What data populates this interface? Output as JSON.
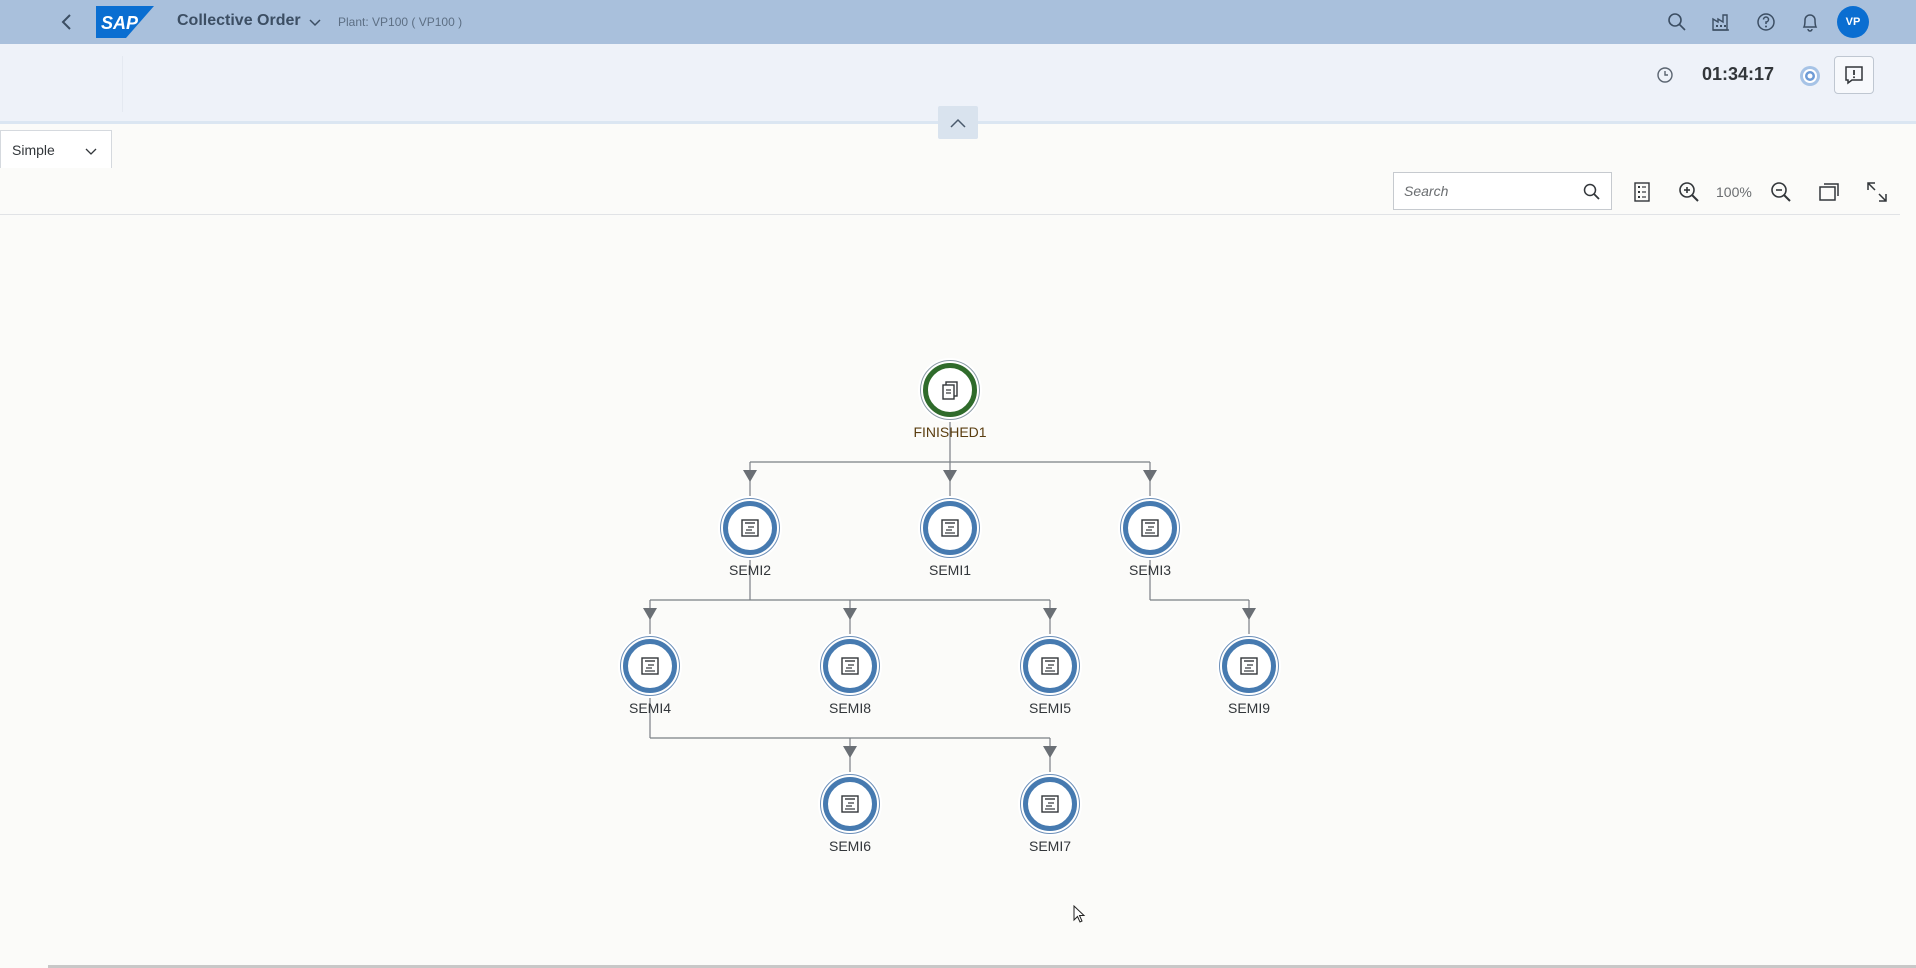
{
  "shell": {
    "title": "Collective Order",
    "plant": "Plant: VP100 ( VP100 )",
    "avatar_initials": "VP",
    "logo_text": "SAP"
  },
  "header": {
    "timer": "01:34:17"
  },
  "view_select": {
    "value": "Simple"
  },
  "toolbar": {
    "search_placeholder": "Search",
    "zoom_level": "100%"
  },
  "graph": {
    "nodes": [
      {
        "id": "FINISHED1",
        "label": "FINISHED1",
        "type": "finished"
      },
      {
        "id": "SEMI2",
        "label": "SEMI2",
        "type": "semi"
      },
      {
        "id": "SEMI1",
        "label": "SEMI1",
        "type": "semi"
      },
      {
        "id": "SEMI3",
        "label": "SEMI3",
        "type": "semi"
      },
      {
        "id": "SEMI4",
        "label": "SEMI4",
        "type": "semi"
      },
      {
        "id": "SEMI8",
        "label": "SEMI8",
        "type": "semi"
      },
      {
        "id": "SEMI5",
        "label": "SEMI5",
        "type": "semi"
      },
      {
        "id": "SEMI9",
        "label": "SEMI9",
        "type": "semi"
      },
      {
        "id": "SEMI6",
        "label": "SEMI6",
        "type": "semi"
      },
      {
        "id": "SEMI7",
        "label": "SEMI7",
        "type": "semi"
      }
    ],
    "edges": [
      [
        "FINISHED1",
        "SEMI2"
      ],
      [
        "FINISHED1",
        "SEMI1"
      ],
      [
        "FINISHED1",
        "SEMI3"
      ],
      [
        "SEMI2",
        "SEMI4"
      ],
      [
        "SEMI2",
        "SEMI8"
      ],
      [
        "SEMI2",
        "SEMI5"
      ],
      [
        "SEMI3",
        "SEMI9"
      ],
      [
        "SEMI4",
        "SEMI6"
      ],
      [
        "SEMI4",
        "SEMI7"
      ]
    ]
  },
  "colors": {
    "shell_bg": "#a9c0dc",
    "node_ring": "#467ab0",
    "finished_ring": "#2f6b2b",
    "avatar_bg": "#0a6ed1"
  }
}
